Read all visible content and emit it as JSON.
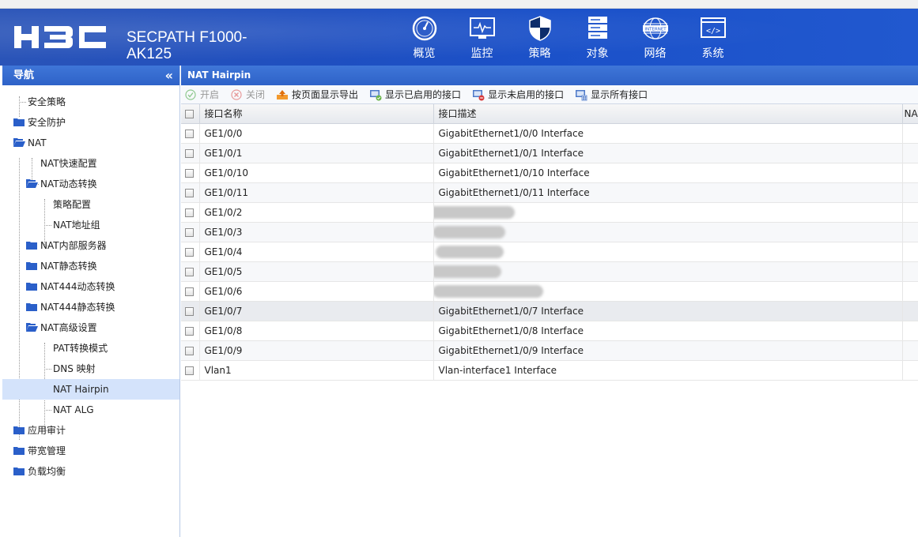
{
  "brand": {
    "logo_text": "H3C",
    "product_line1": "SECPATH F1000-",
    "product_line2": "AK125"
  },
  "topnav": [
    {
      "label": "概览",
      "icon": "dashboard-icon"
    },
    {
      "label": "监控",
      "icon": "monitor-icon"
    },
    {
      "label": "策略",
      "icon": "shield-icon"
    },
    {
      "label": "对象",
      "icon": "server-icon"
    },
    {
      "label": "网络",
      "icon": "internet-globe-icon"
    },
    {
      "label": "系统",
      "icon": "code-window-icon"
    }
  ],
  "sidebar": {
    "title": "导航",
    "collapse_glyph": "«",
    "items": [
      {
        "label": "安全策略"
      },
      {
        "label": "安全防护"
      },
      {
        "label": "NAT"
      },
      {
        "label": "NAT快速配置"
      },
      {
        "label": "NAT动态转换"
      },
      {
        "label": "策略配置"
      },
      {
        "label": "NAT地址组"
      },
      {
        "label": "NAT内部服务器"
      },
      {
        "label": "NAT静态转换"
      },
      {
        "label": "NAT444动态转换"
      },
      {
        "label": "NAT444静态转换"
      },
      {
        "label": "NAT高级设置"
      },
      {
        "label": "PAT转换模式"
      },
      {
        "label": "DNS 映射"
      },
      {
        "label": "NAT Hairpin"
      },
      {
        "label": "NAT ALG"
      },
      {
        "label": "应用审计"
      },
      {
        "label": "带宽管理"
      },
      {
        "label": "负载均衡"
      }
    ]
  },
  "main": {
    "title": "NAT Hairpin",
    "toolbar": {
      "enable": "开启",
      "disable": "关闭",
      "export": "按页面显示导出",
      "show_enabled": "显示已启用的接口",
      "show_disabled": "显示未启用的接口",
      "show_all": "显示所有接口"
    },
    "columns": {
      "name": "接口名称",
      "desc": "接口描述",
      "third": "NA"
    },
    "rows": [
      {
        "name": "GE1/0/0",
        "desc": "GigabitEthernet1/0/0 Interface"
      },
      {
        "name": "GE1/0/1",
        "desc": "GigabitEthernet1/0/1 Interface"
      },
      {
        "name": "GE1/0/10",
        "desc": "GigabitEthernet1/0/10 Interface"
      },
      {
        "name": "GE1/0/11",
        "desc": "GigabitEthernet1/0/11 Interface"
      },
      {
        "name": "GE1/0/2",
        "desc": ""
      },
      {
        "name": "GE1/0/3",
        "desc": ""
      },
      {
        "name": "GE1/0/4",
        "desc": ""
      },
      {
        "name": "GE1/0/5",
        "desc": ""
      },
      {
        "name": "GE1/0/6",
        "desc": ""
      },
      {
        "name": "GE1/0/7",
        "desc": "GigabitEthernet1/0/7 Interface"
      },
      {
        "name": "GE1/0/8",
        "desc": "GigabitEthernet1/0/8 Interface"
      },
      {
        "name": "GE1/0/9",
        "desc": "GigabitEthernet1/0/9 Interface"
      },
      {
        "name": "Vlan1",
        "desc": "Vlan-interface1 Interface"
      }
    ]
  }
}
